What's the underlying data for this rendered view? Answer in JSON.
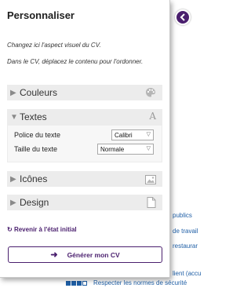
{
  "panel": {
    "title": "Personnaliser",
    "hint1": "Changez ici l'aspect visuel du CV.",
    "hint2": "Dans le CV, déplacez le contenu pour l'ordonner.",
    "close_icon": "chevron-left-icon"
  },
  "sections": {
    "couleurs": {
      "label": "Couleurs",
      "icon": "palette-icon",
      "expanded": false
    },
    "textes": {
      "label": "Textes",
      "icon": "font-icon",
      "expanded": true
    },
    "icones": {
      "label": "Icônes",
      "icon": "image-icon",
      "expanded": false
    },
    "design": {
      "label": "Design",
      "icon": "document-icon",
      "expanded": false
    }
  },
  "textes": {
    "police_label": "Police du texte",
    "police_value": "Calibri",
    "taille_label": "Taille du texte",
    "taille_value": "Normale"
  },
  "actions": {
    "reset_label": "Revenir à l'état initial",
    "generate_label": "Générer mon CV"
  },
  "background": {
    "lines": [
      "publics",
      "de travail",
      "restaurar",
      "lient (accu"
    ],
    "bottom_text": "Respecter les normes de sécurité"
  },
  "colors": {
    "accent": "#4a1f6e",
    "link": "#1f5fa6",
    "section_bg": "#ececec"
  }
}
